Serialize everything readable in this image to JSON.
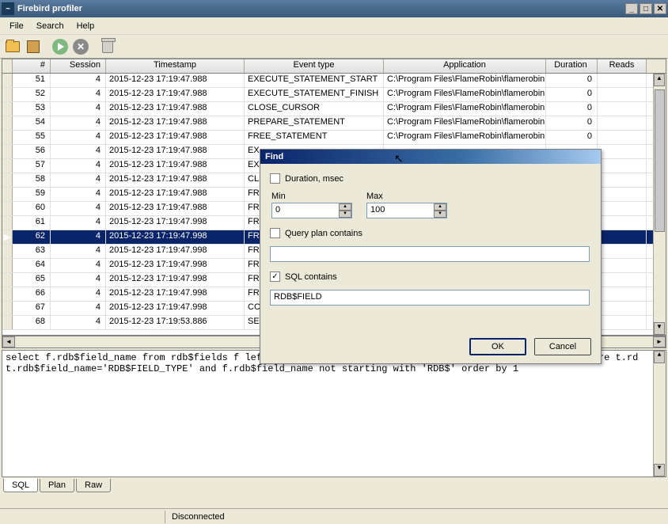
{
  "window": {
    "title": "Firebird profiler"
  },
  "menu": {
    "file": "File",
    "search": "Search",
    "help": "Help"
  },
  "grid": {
    "headers": {
      "num": "#",
      "session": "Session",
      "timestamp": "Timestamp",
      "event": "Event type",
      "app": "Application",
      "duration": "Duration",
      "reads": "Reads"
    },
    "rows": [
      {
        "n": "51",
        "s": "4",
        "ts": "2015-12-23 17:19:47.988",
        "evt": "EXECUTE_STATEMENT_START",
        "app": "C:\\Program Files\\FlameRobin\\flamerobin.",
        "dur": "0"
      },
      {
        "n": "52",
        "s": "4",
        "ts": "2015-12-23 17:19:47.988",
        "evt": "EXECUTE_STATEMENT_FINISH",
        "app": "C:\\Program Files\\FlameRobin\\flamerobin.",
        "dur": "0"
      },
      {
        "n": "53",
        "s": "4",
        "ts": "2015-12-23 17:19:47.988",
        "evt": "CLOSE_CURSOR",
        "app": "C:\\Program Files\\FlameRobin\\flamerobin.",
        "dur": "0"
      },
      {
        "n": "54",
        "s": "4",
        "ts": "2015-12-23 17:19:47.988",
        "evt": "PREPARE_STATEMENT",
        "app": "C:\\Program Files\\FlameRobin\\flamerobin.",
        "dur": "0"
      },
      {
        "n": "55",
        "s": "4",
        "ts": "2015-12-23 17:19:47.988",
        "evt": "FREE_STATEMENT",
        "app": "C:\\Program Files\\FlameRobin\\flamerobin.",
        "dur": "0"
      },
      {
        "n": "56",
        "s": "4",
        "ts": "2015-12-23 17:19:47.988",
        "evt": "EX",
        "app": "",
        "dur": ""
      },
      {
        "n": "57",
        "s": "4",
        "ts": "2015-12-23 17:19:47.988",
        "evt": "EX",
        "app": "",
        "dur": ""
      },
      {
        "n": "58",
        "s": "4",
        "ts": "2015-12-23 17:19:47.988",
        "evt": "CL",
        "app": "",
        "dur": ""
      },
      {
        "n": "59",
        "s": "4",
        "ts": "2015-12-23 17:19:47.988",
        "evt": "FR",
        "app": "",
        "dur": ""
      },
      {
        "n": "60",
        "s": "4",
        "ts": "2015-12-23 17:19:47.988",
        "evt": "FR",
        "app": "",
        "dur": ""
      },
      {
        "n": "61",
        "s": "4",
        "ts": "2015-12-23 17:19:47.998",
        "evt": "FR",
        "app": "",
        "dur": ""
      },
      {
        "n": "62",
        "s": "4",
        "ts": "2015-12-23 17:19:47.998",
        "evt": "FR",
        "app": "",
        "dur": "",
        "sel": true
      },
      {
        "n": "63",
        "s": "4",
        "ts": "2015-12-23 17:19:47.998",
        "evt": "FR",
        "app": "",
        "dur": ""
      },
      {
        "n": "64",
        "s": "4",
        "ts": "2015-12-23 17:19:47.998",
        "evt": "FR",
        "app": "",
        "dur": ""
      },
      {
        "n": "65",
        "s": "4",
        "ts": "2015-12-23 17:19:47.998",
        "evt": "FR",
        "app": "",
        "dur": ""
      },
      {
        "n": "66",
        "s": "4",
        "ts": "2015-12-23 17:19:47.998",
        "evt": "FR",
        "app": "",
        "dur": ""
      },
      {
        "n": "67",
        "s": "4",
        "ts": "2015-12-23 17:19:47.998",
        "evt": "CC",
        "app": "",
        "dur": ""
      },
      {
        "n": "68",
        "s": "4",
        "ts": "2015-12-23 17:19:53.886",
        "evt": "SE",
        "app": "",
        "dur": ""
      }
    ]
  },
  "sql": {
    "line1": "select f.rdb$field_name from rdb$fields f left outer join rdb$types t on f.rdb$field_type=t.rdb$type where t.rdb$field_name",
    "line2": "t.rdb$field_name='RDB$FIELD_TYPE' and f.rdb$field_name not starting with 'RDB$' order by 1"
  },
  "tabs": {
    "sql": "SQL",
    "plan": "Plan",
    "raw": "Raw"
  },
  "status": {
    "text": "Disconnected"
  },
  "dialog": {
    "title": "Find",
    "duration_label": "Duration, msec",
    "min_label": "Min",
    "min_val": "0",
    "max_label": "Max",
    "max_val": "100",
    "queryplan_label": "Query plan contains",
    "queryplan_val": "",
    "sql_label": "SQL contains",
    "sql_val": "RDB$FIELD",
    "ok": "OK",
    "cancel": "Cancel"
  }
}
